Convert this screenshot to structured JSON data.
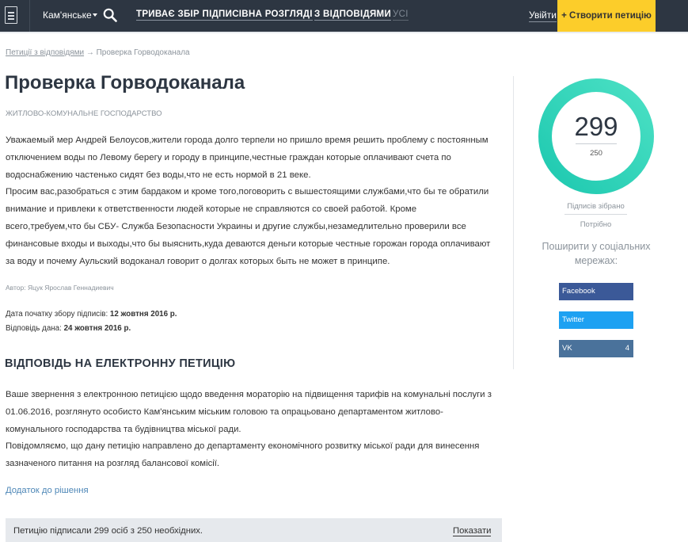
{
  "header": {
    "city": "Кам'янське",
    "nav": [
      {
        "label": "ТРИВАЄ ЗБІР ПІДПИСІВ"
      },
      {
        "label": "НА РОЗГЛЯДІ"
      },
      {
        "label": "З ВІДПОВІДЯМИ"
      },
      {
        "label": "УСІ"
      }
    ],
    "login": "Увійти",
    "create": "+ Створити петицію"
  },
  "breadcrumb": {
    "link": "Петиції з відповідями",
    "arrow": "→",
    "current": "Проверка Горводоканала"
  },
  "petition": {
    "title": "Проверка Горводоканала",
    "category": "ЖИТЛОВО-КОМУНАЛЬНЕ ГОСПОДАРСТВО",
    "text_lines": [
      "Уважаемый мер Андрей Белоусов,жители города долго терпели но пришло время решить проблему с постоянным",
      "отключением воды по Левому берегу и городу в принципе,честные граждан которые оплачивают счета по",
      "водоснабжению частенько сидят без воды,что не есть нормой в 21 веке.",
      "Просим вас,разобраться с этим бардаком и кроме того,поговорить с вышестоящими службами,что бы те обратили",
      "внимание и привлеки к ответственности людей которые не справляются со своей работой. Кроме",
      "всего,требуем,что бы СБУ- Служба Безопасности Украины и другие службы,незамедлительно проверили все",
      "финансовые входы и выходы,что бы выяснить,куда деваются деньги которые честные горожан города оплачивают",
      "за воду и почему Аульский водоканал говорит о долгах которых быть не может в принципе."
    ],
    "author": "Автор: Яцук Ярослав Геннадиевич",
    "start_label": "Дата початку збору підписів:",
    "start_date": "12 жовтня 2016 р.",
    "answer_label": "Відповідь дана:",
    "answer_date": "24 жовтня 2016 р."
  },
  "response": {
    "heading": "ВІДПОВІДЬ НА ЕЛЕКТРОННУ ПЕТИЦІЮ",
    "lines": [
      "Ваше звернення з електронною петицією щодо введення мораторію на підвищення тарифів на комунальні послуги з",
      "01.06.2016, розглянуто особисто Кам'янським міським головою та опрацьовано департаментом житлово-",
      "комунального господарства та будівництва міської ради.",
      "Повідомляємо, що дану петицію направлено до департаменту економічного розвитку міської ради для винесення",
      "зазначеного питання на розгляд балансової комісії."
    ],
    "attachment": "Додаток до рішення",
    "signers": "Петицію підписали 299 осіб з 250 необхідних.",
    "show": "Показати"
  },
  "sidebar": {
    "count": "299",
    "goal": "250",
    "progress_fraction": 1.0,
    "ring_colors": [
      "#1ec9b0",
      "#4be0c4"
    ],
    "collected_label": "Підписів зібрано",
    "needed_label": "Потрібно",
    "share_line1": "Поширити у соціальних",
    "share_line2": "мережах:",
    "social": [
      {
        "label": "Facebook",
        "count": "",
        "color": "#3b5998"
      },
      {
        "label": "Twitter",
        "count": "",
        "color": "#1da1f2"
      },
      {
        "label": "VK",
        "count": "4",
        "color": "#4a729b"
      }
    ]
  }
}
